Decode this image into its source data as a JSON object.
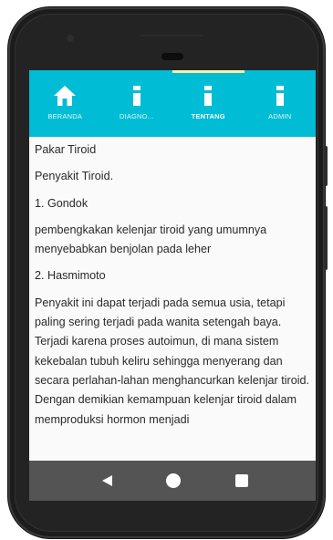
{
  "tabs": [
    {
      "label": "BERANDA",
      "icon": "home-icon"
    },
    {
      "label": "DIAGNO...",
      "icon": "info-icon"
    },
    {
      "label": "TENTANG",
      "icon": "info-icon",
      "active": true
    },
    {
      "label": "ADMIN",
      "icon": "info-icon"
    }
  ],
  "content": {
    "title": "Pakar Tiroid",
    "heading": "Penyakit Tiroid.",
    "item1_title": "1. Gondok",
    "item1_desc": "pembengkakan kelenjar tiroid yang umumnya menyebabkan benjolan pada leher",
    "item2_title": "2. Hasmimoto",
    "item2_desc": "Penyakit ini dapat terjadi pada semua usia, tetapi paling sering terjadi pada wanita setengah baya. Terjadi karena proses autoimun, di mana sistem kekebalan tubuh keliru sehingga menyerang dan secara perlahan-lahan menghancurkan kelenjar tiroid. Dengan demikian kemampuan kelenjar tiroid dalam memproduksi hormon menjadi"
  },
  "navbar": {
    "back_icon": "back-triangle-icon",
    "home_icon": "home-circle-icon",
    "recent_icon": "recent-apps-icon"
  },
  "colors": {
    "accent": "#00bcd4",
    "indicator": "#f4f6a8",
    "navbar": "#545454",
    "text": "#2a2a2a"
  }
}
